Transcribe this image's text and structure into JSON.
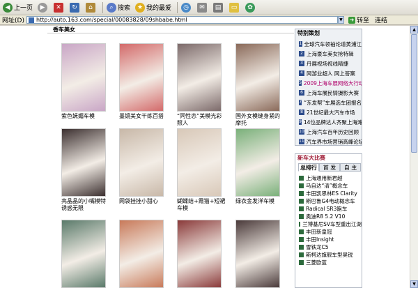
{
  "toolbar": {
    "back_label": "上一页",
    "search_label": "搜索",
    "favorites_label": "我的最爱"
  },
  "address": {
    "label": "网址(D)",
    "url": "http://auto.163.com/special/00083828/09shbabe.html",
    "go_label": "转至",
    "links_label": "连结"
  },
  "main": {
    "title": "香车美女",
    "photos": [
      {
        "caption": "紫色妩媚车模",
        "color": "#c9a6c6"
      },
      {
        "caption": "墨镜美女干练百搭",
        "color": "#d36a6a"
      },
      {
        "caption": "“同性恋”美模光彩照人",
        "color": "#7c6a6a"
      },
      {
        "caption": "国外女模缝身紧的摩托",
        "color": "#8a6a5a"
      },
      {
        "caption": "亮晶晶的小嘴模特诱惑无限",
        "color": "#3c3030"
      },
      {
        "caption": "网袋挂挂小甜心",
        "color": "#c8b8a8"
      },
      {
        "caption": "蝴蝶结+霞猫+短裙车模",
        "color": "#d8c8b8"
      },
      {
        "caption": "绿衣金发洋车模",
        "color": "#7ab07a"
      },
      {
        "caption": "",
        "color": "#5a7a6a"
      },
      {
        "caption": "",
        "color": "#c87a5a"
      },
      {
        "caption": "",
        "color": "#8a3a3a"
      },
      {
        "caption": "",
        "color": "#4a3a3a"
      }
    ]
  },
  "sidebar": {
    "special_title": "特别策划",
    "special_items": [
      "全球汽车领袖论道黄浦江",
      "上海豪车美女抢特辑",
      "丹展视场视线精捷",
      "网游业超人 网上答案",
      "2009上海车展网络大行动",
      "上海车展民情摄影大赛",
      "“东发帮”车展选车团报名",
      "21世纪最大汽车市场",
      "14位品牌达人齐聚上海滩",
      "上海汽车百年历史回顾",
      "汽车界市场营销高峰论坛"
    ],
    "new_cars_title": "新车大比赛",
    "tabs": [
      "总排行",
      "首 发",
      "自 主"
    ],
    "new_cars": [
      "上海通用新君越",
      "马自达“清”概念车",
      "丰田凯思林ES Clarity",
      "斯巴鲁G4电动概念车",
      "Radical SR3跑车",
      "奥迪R8 5.2 V10",
      "兰博基尼SV车型重出江湖",
      "丰田新皇冠",
      "丰田Insight",
      "雪铁龙C5",
      "斯柯达旗舰车型昊锐",
      "三菱欧蓝"
    ]
  },
  "colors": {
    "accent": "#2c4c8c",
    "panel": "#eef1f4"
  }
}
